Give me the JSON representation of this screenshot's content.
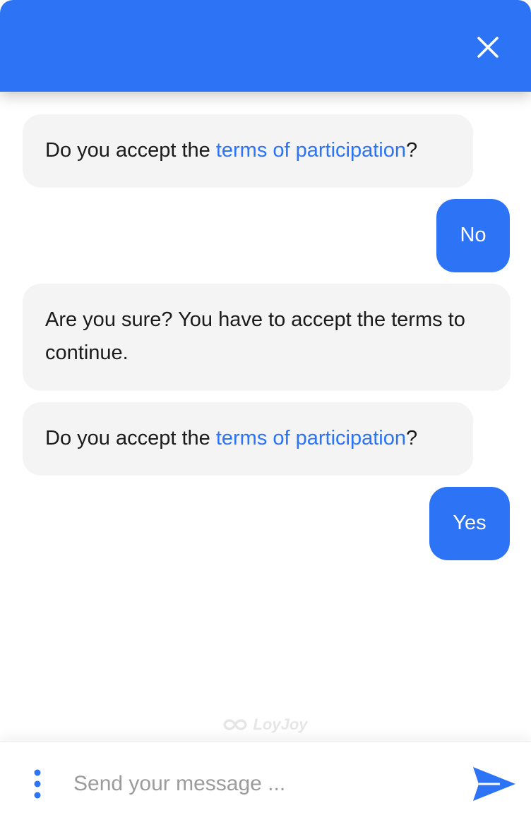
{
  "header": {
    "close_icon": "close-icon"
  },
  "messages": [
    {
      "sender": "bot",
      "prefix": "Do you accept the ",
      "link": "terms of participation",
      "suffix": "?"
    },
    {
      "sender": "user",
      "text": "No"
    },
    {
      "sender": "bot",
      "text": "Are you sure? You have to accept the terms to continue."
    },
    {
      "sender": "bot",
      "prefix": "Do you accept the ",
      "link": "terms of participation",
      "suffix": "?"
    },
    {
      "sender": "user",
      "text": "Yes"
    }
  ],
  "branding": {
    "name": "LoyJoy",
    "logo_icon": "infinity-logo-icon"
  },
  "composer": {
    "placeholder": "Send your message ...",
    "menu_icon": "vertical-dots-icon",
    "send_icon": "send-arrow-icon"
  },
  "colors": {
    "accent": "#2c73f5",
    "bot_bubble": "#f4f4f4",
    "text": "#1b1b1b",
    "branding": "#e6e6e6"
  }
}
